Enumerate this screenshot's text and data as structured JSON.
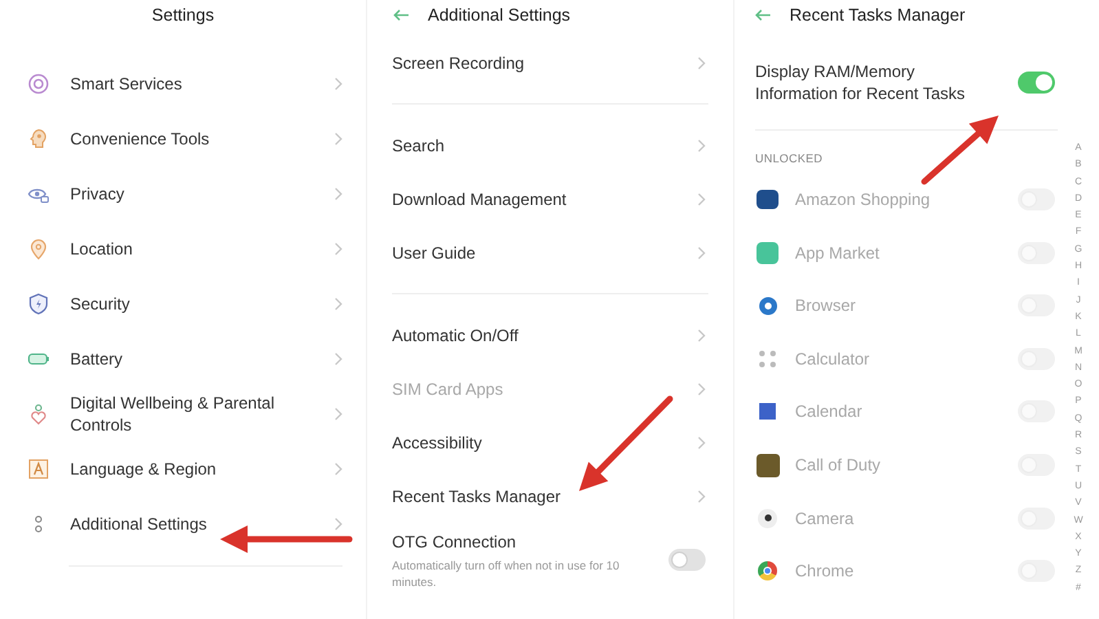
{
  "settings_screen": {
    "title": "Settings",
    "items": [
      {
        "label": "Smart Services"
      },
      {
        "label": "Convenience Tools"
      },
      {
        "label": "Privacy"
      },
      {
        "label": "Location"
      },
      {
        "label": "Security"
      },
      {
        "label": "Battery"
      },
      {
        "label": "Digital Wellbeing & Parental Controls"
      },
      {
        "label": "Language & Region"
      },
      {
        "label": "Additional Settings"
      }
    ]
  },
  "additional_settings_screen": {
    "title": "Additional Settings",
    "groups": [
      [
        {
          "kind": "link",
          "label": "Screen Recording",
          "disabled": false
        }
      ],
      [
        {
          "kind": "link",
          "label": "Search",
          "disabled": false
        },
        {
          "kind": "link",
          "label": "Download Management",
          "disabled": false
        },
        {
          "kind": "link",
          "label": "User Guide",
          "disabled": false
        }
      ],
      [
        {
          "kind": "link",
          "label": "Automatic On/Off",
          "disabled": false
        },
        {
          "kind": "link",
          "label": "SIM Card Apps",
          "disabled": true
        },
        {
          "kind": "link",
          "label": "Accessibility",
          "disabled": false
        },
        {
          "kind": "link",
          "label": "Recent Tasks Manager",
          "disabled": false
        },
        {
          "kind": "toggle",
          "label": "OTG Connection",
          "subtitle": "Automatically turn off when not in use for 10 minutes.",
          "disabled": false,
          "on": false
        }
      ]
    ]
  },
  "recent_tasks_screen": {
    "title": "Recent Tasks Manager",
    "main_toggle": {
      "label": "Display RAM/Memory Information for Recent Tasks",
      "on": true
    },
    "section": "UNLOCKED",
    "apps": [
      {
        "label": "Amazon Shopping",
        "disabled": true,
        "on": false
      },
      {
        "label": "App Market",
        "disabled": true,
        "on": false
      },
      {
        "label": "Browser",
        "disabled": true,
        "on": false
      },
      {
        "label": "Calculator",
        "disabled": true,
        "on": false
      },
      {
        "label": "Calendar",
        "disabled": true,
        "on": false
      },
      {
        "label": "Call of Duty",
        "disabled": true,
        "on": false
      },
      {
        "label": "Camera",
        "disabled": true,
        "on": false
      },
      {
        "label": "Chrome",
        "disabled": true,
        "on": false
      }
    ],
    "index": [
      "A",
      "B",
      "C",
      "D",
      "E",
      "F",
      "G",
      "H",
      "I",
      "J",
      "K",
      "L",
      "M",
      "N",
      "O",
      "P",
      "Q",
      "R",
      "S",
      "T",
      "U",
      "V",
      "W",
      "X",
      "Y",
      "Z",
      "#"
    ]
  }
}
